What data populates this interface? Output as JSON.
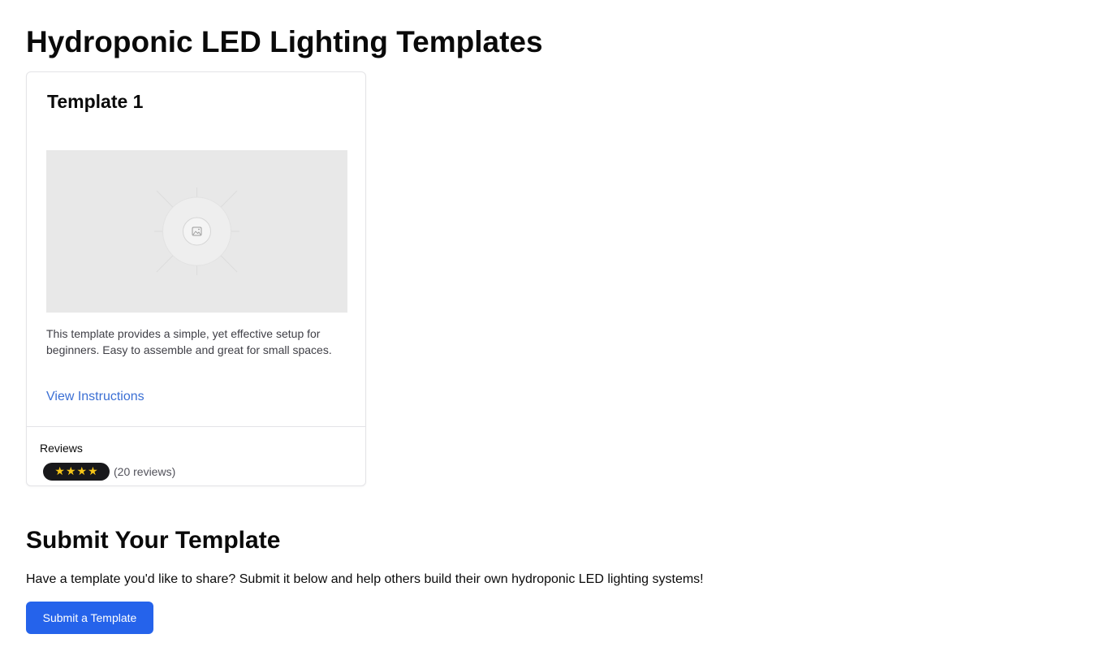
{
  "header": {
    "title": "Hydroponic LED Lighting Templates"
  },
  "templates": [
    {
      "title": "Template 1",
      "image_icon": "image-placeholder-icon",
      "description": "This template provides a simple, yet effective setup for beginners. Easy to assemble and great for small spaces.",
      "link_label": "View Instructions",
      "reviews_label": "Reviews",
      "rating": 4,
      "star_glyph": "★",
      "review_count_text": "(20 reviews)"
    }
  ],
  "submit_section": {
    "title": "Submit Your Template",
    "text": "Have a template you'd like to share? Submit it below and help others build their own hydroponic LED lighting systems!",
    "button_label": "Submit a Template"
  },
  "colors": {
    "accent": "#2563eb",
    "link": "#3b6fd4",
    "star": "#f5c518",
    "badge_bg": "#18181b",
    "border": "#e4e4e7"
  }
}
